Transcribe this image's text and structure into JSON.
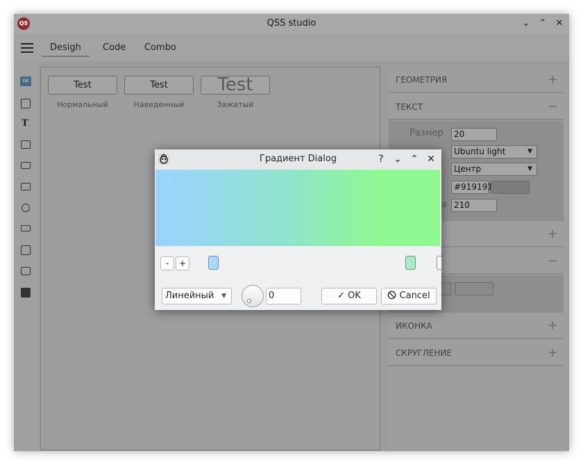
{
  "app": {
    "title": "QSS studio",
    "logo_text": "QS"
  },
  "window_controls": {
    "minimize": "⌄",
    "maximize": "⌃",
    "close": "✕"
  },
  "toolbar": {
    "tabs": [
      "Desigh",
      "Code",
      "Combo"
    ]
  },
  "left_bar": {
    "ok_icon_text": "OK",
    "text_icon_glyph": "T"
  },
  "canvas": {
    "buttons": [
      {
        "label": "Test",
        "caption": "Нормальный"
      },
      {
        "label": "Test",
        "caption": "Наведенный"
      },
      {
        "label": "Test",
        "caption": "Зажатый"
      }
    ]
  },
  "right_panel": {
    "sections": [
      {
        "title": "ГЕОМЕТРИЯ",
        "sign": "+"
      },
      {
        "title": "ТЕКСТ",
        "sign": "−"
      },
      {
        "title": "",
        "sign": "+"
      },
      {
        "title": "",
        "sign": "−"
      },
      {
        "title": "ИКОНКА",
        "sign": "+"
      },
      {
        "title": "СКРУГЛЕНИЕ",
        "sign": "+"
      }
    ],
    "text_props": {
      "size_label": "Размер",
      "size_value": "20",
      "font_value": "Ubuntu light",
      "align_value": "Центр",
      "color_value": "#919191",
      "last_label_fragment": "а",
      "last_value": "210"
    }
  },
  "dialog": {
    "title": "Градиент Dialog",
    "help": "?",
    "minimize": "⌄",
    "maximize": "⌃",
    "close": "✕",
    "remove_stop": "-",
    "add_stop": "+",
    "mode": "Линейный",
    "angle": "0",
    "ok_label": "OK",
    "cancel_label": "Cancel",
    "ok_glyph": "✓",
    "cancel_glyph": "⃠",
    "colors": {
      "start": "#9ad2ff",
      "mid": "#8fe3cf",
      "end": "#90f890",
      "stop1": "#a8d8fb",
      "stop2": "#a9ecc4"
    }
  }
}
